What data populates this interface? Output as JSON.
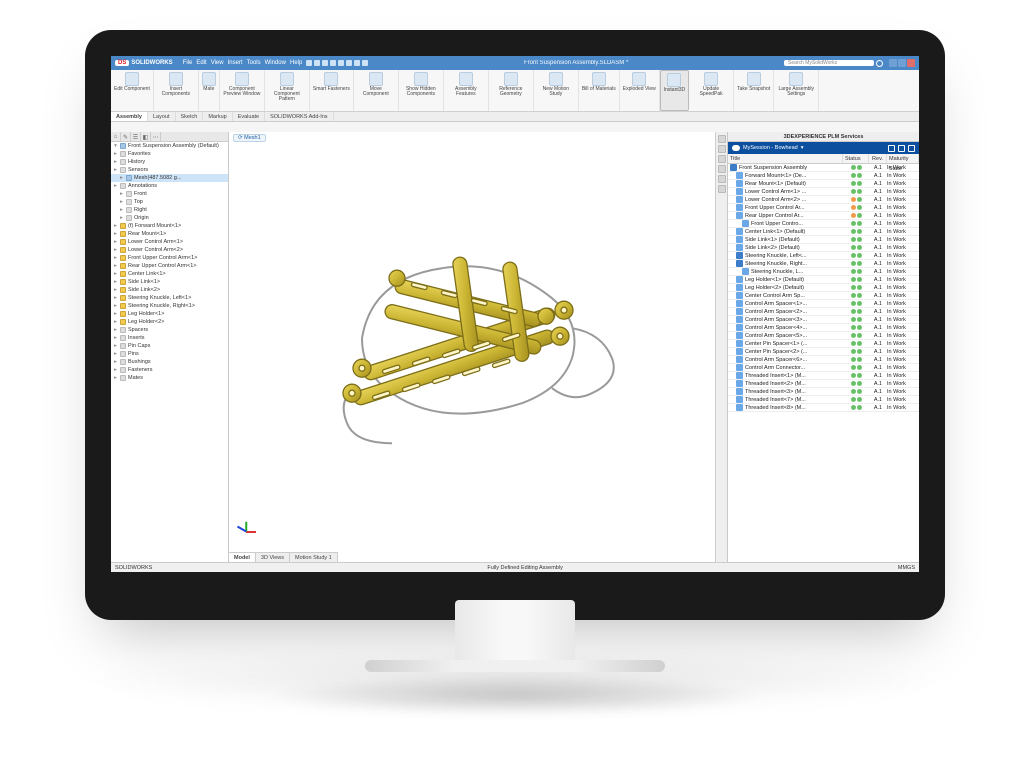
{
  "app": {
    "brand_prefix": "DS",
    "brand": "SOLIDWORKS",
    "doc_title": "Front Suspension Assembly.SLDASM *",
    "search_placeholder": "Search MySolidWorks"
  },
  "menu": [
    "File",
    "Edit",
    "View",
    "Insert",
    "Tools",
    "Window",
    "Help"
  ],
  "ribbon": [
    {
      "label": "Edit Component"
    },
    {
      "label": "Insert Components"
    },
    {
      "label": "Mate"
    },
    {
      "label": "Component Preview Window"
    },
    {
      "label": "Linear Component Pattern"
    },
    {
      "label": "Smart Fasteners"
    },
    {
      "label": "Move Component"
    },
    {
      "label": "Show Hidden Components"
    },
    {
      "label": "Assembly Features"
    },
    {
      "label": "Reference Geometry"
    },
    {
      "label": "New Motion Study"
    },
    {
      "label": "Bill of Materials"
    },
    {
      "label": "Exploded View"
    },
    {
      "label": "Instant3D",
      "selected": true
    },
    {
      "label": "Update SpeedPak"
    },
    {
      "label": "Take Snapshot"
    },
    {
      "label": "Large Assembly Settings"
    }
  ],
  "cmd_tabs": [
    "Assembly",
    "Layout",
    "Sketch",
    "Markup",
    "Evaluate",
    "SOLIDWORKS Add-Ins"
  ],
  "cmd_tab_active": "Assembly",
  "breadcrumb": "Mesh1",
  "feature_tree": {
    "root": "Front Suspension Assembly (Default)",
    "items": [
      {
        "t": "Favorites",
        "ico": "grey"
      },
      {
        "t": "History",
        "ico": "grey"
      },
      {
        "t": "Sensors",
        "ico": "grey"
      },
      {
        "t": "Mesh(487.5082 g...",
        "ico": "blue",
        "sel": true,
        "ind": 1
      },
      {
        "t": "Annotations",
        "ico": "grey"
      },
      {
        "t": "Front",
        "ico": "grey",
        "ind": 1
      },
      {
        "t": "Top",
        "ico": "grey",
        "ind": 1
      },
      {
        "t": "Right",
        "ico": "grey",
        "ind": 1
      },
      {
        "t": "Origin",
        "ico": "grey",
        "ind": 1
      },
      {
        "t": "(f) Forward Mount<1>",
        "ico": "yel"
      },
      {
        "t": "Rear Mount<1>",
        "ico": "yel"
      },
      {
        "t": "Lower Control Arm<1>",
        "ico": "yel"
      },
      {
        "t": "Lower Control Arm<2>",
        "ico": "yel"
      },
      {
        "t": "Front Upper Control Arm<1>",
        "ico": "yel"
      },
      {
        "t": "Rear Upper Control Arm<1>",
        "ico": "yel"
      },
      {
        "t": "Center Link<1>",
        "ico": "yel"
      },
      {
        "t": "Side Link<1>",
        "ico": "yel"
      },
      {
        "t": "Side Link<2>",
        "ico": "yel"
      },
      {
        "t": "Steering Knuckle, Left<1>",
        "ico": "yel"
      },
      {
        "t": "Steering Knuckle, Right<1>",
        "ico": "yel"
      },
      {
        "t": "Leg Holder<1>",
        "ico": "yel"
      },
      {
        "t": "Leg Holder<2>",
        "ico": "yel"
      },
      {
        "t": "Spacers",
        "ico": "grey"
      },
      {
        "t": "Inserts",
        "ico": "grey"
      },
      {
        "t": "Pin Caps",
        "ico": "grey"
      },
      {
        "t": "Pins",
        "ico": "grey"
      },
      {
        "t": "Bushings",
        "ico": "grey"
      },
      {
        "t": "Fasteners",
        "ico": "grey"
      },
      {
        "t": "Mates",
        "ico": "grey"
      }
    ]
  },
  "bottom_tabs": [
    "Model",
    "3D Views",
    "Motion Study 1"
  ],
  "bottom_tab_active": "Model",
  "status": {
    "left": "SOLIDWORKS",
    "center": "Fully Defined   Editing Assembly",
    "right": "MMGS"
  },
  "plm": {
    "title": "3DEXPERIENCE PLM Services",
    "session_label": "MySession - Bowhead",
    "columns": [
      "Title",
      "Status",
      "Rev.",
      "Maturity State"
    ],
    "rows": [
      {
        "t": "Front Suspension Assembly",
        "ico": "asm",
        "ind": 0,
        "status": "g",
        "rev": "A.1",
        "mat": "In Work"
      },
      {
        "t": "Forward Mount<1> (De...",
        "ico": "prt",
        "ind": 1,
        "status": "g",
        "rev": "A.1",
        "mat": "In Work"
      },
      {
        "t": "Rear Mount<1> (Default)",
        "ico": "prt",
        "ind": 1,
        "status": "g",
        "rev": "A.1",
        "mat": "In Work"
      },
      {
        "t": "Lower Control Arm<1> ...",
        "ico": "prt",
        "ind": 1,
        "status": "g",
        "rev": "A.1",
        "mat": "In Work"
      },
      {
        "t": "Lower Control Arm<2> ...",
        "ico": "prt",
        "ind": 1,
        "status": "o",
        "rev": "A.1",
        "mat": "In Work"
      },
      {
        "t": "Front Upper Control Ar...",
        "ico": "prt",
        "ind": 1,
        "status": "o",
        "rev": "A.1",
        "mat": "In Work"
      },
      {
        "t": "Rear Upper Control Ar...",
        "ico": "prt",
        "ind": 1,
        "status": "o",
        "rev": "A.1",
        "mat": "In Work"
      },
      {
        "t": "Front Upper Contro...",
        "ico": "prt",
        "ind": 2,
        "status": "g",
        "rev": "A.1",
        "mat": "In Work"
      },
      {
        "t": "Center Link<1> (Default)",
        "ico": "prt",
        "ind": 1,
        "status": "g",
        "rev": "A.1",
        "mat": "In Work"
      },
      {
        "t": "Side Link<1> (Default)",
        "ico": "prt",
        "ind": 1,
        "status": "g",
        "rev": "A.1",
        "mat": "In Work"
      },
      {
        "t": "Side Link<2> (Default)",
        "ico": "prt",
        "ind": 1,
        "status": "g",
        "rev": "A.1",
        "mat": "In Work"
      },
      {
        "t": "Steering Knuckle, Left<...",
        "ico": "asm",
        "ind": 1,
        "status": "g",
        "rev": "A.1",
        "mat": "In Work"
      },
      {
        "t": "Steering Knuckle, Right...",
        "ico": "asm",
        "ind": 1,
        "status": "g",
        "rev": "A.1",
        "mat": "In Work"
      },
      {
        "t": "Steering Knuckle, L...",
        "ico": "prt",
        "ind": 2,
        "status": "g",
        "rev": "A.1",
        "mat": "In Work"
      },
      {
        "t": "Leg Holder<1> (Default)",
        "ico": "prt",
        "ind": 1,
        "status": "g",
        "rev": "A.1",
        "mat": "In Work"
      },
      {
        "t": "Leg Holder<2> (Default)",
        "ico": "prt",
        "ind": 1,
        "status": "g",
        "rev": "A.1",
        "mat": "In Work"
      },
      {
        "t": "Center Control Arm Sp...",
        "ico": "prt",
        "ind": 1,
        "status": "g",
        "rev": "A.1",
        "mat": "In Work"
      },
      {
        "t": "Control Arm Spacer<1>...",
        "ico": "prt",
        "ind": 1,
        "status": "g",
        "rev": "A.1",
        "mat": "In Work"
      },
      {
        "t": "Control Arm Spacer<2>...",
        "ico": "prt",
        "ind": 1,
        "status": "g",
        "rev": "A.1",
        "mat": "In Work"
      },
      {
        "t": "Control Arm Spacer<3>...",
        "ico": "prt",
        "ind": 1,
        "status": "g",
        "rev": "A.1",
        "mat": "In Work"
      },
      {
        "t": "Control Arm Spacer<4>...",
        "ico": "prt",
        "ind": 1,
        "status": "g",
        "rev": "A.1",
        "mat": "In Work"
      },
      {
        "t": "Control Arm Spacer<5>...",
        "ico": "prt",
        "ind": 1,
        "status": "g",
        "rev": "A.1",
        "mat": "In Work"
      },
      {
        "t": "Center Pin Spacer<1> (...",
        "ico": "prt",
        "ind": 1,
        "status": "g",
        "rev": "A.1",
        "mat": "In Work"
      },
      {
        "t": "Center Pin Spacer<2> (...",
        "ico": "prt",
        "ind": 1,
        "status": "g",
        "rev": "A.1",
        "mat": "In Work"
      },
      {
        "t": "Control Arm Spacer<6>...",
        "ico": "prt",
        "ind": 1,
        "status": "g",
        "rev": "A.1",
        "mat": "In Work"
      },
      {
        "t": "Control Arm Connector...",
        "ico": "prt",
        "ind": 1,
        "status": "g",
        "rev": "A.1",
        "mat": "In Work"
      },
      {
        "t": "Threaded Insert<1> (M...",
        "ico": "prt",
        "ind": 1,
        "status": "g",
        "rev": "A.1",
        "mat": "In Work"
      },
      {
        "t": "Threaded Insert<2> (M...",
        "ico": "prt",
        "ind": 1,
        "status": "g",
        "rev": "A.1",
        "mat": "In Work"
      },
      {
        "t": "Threaded Insert<3> (M...",
        "ico": "prt",
        "ind": 1,
        "status": "g",
        "rev": "A.1",
        "mat": "In Work"
      },
      {
        "t": "Threaded Insert<7> (M...",
        "ico": "prt",
        "ind": 1,
        "status": "g",
        "rev": "A.1",
        "mat": "In Work"
      },
      {
        "t": "Threaded Insert<8> (M...",
        "ico": "prt",
        "ind": 1,
        "status": "g",
        "rev": "A.1",
        "mat": "In Work"
      }
    ]
  }
}
